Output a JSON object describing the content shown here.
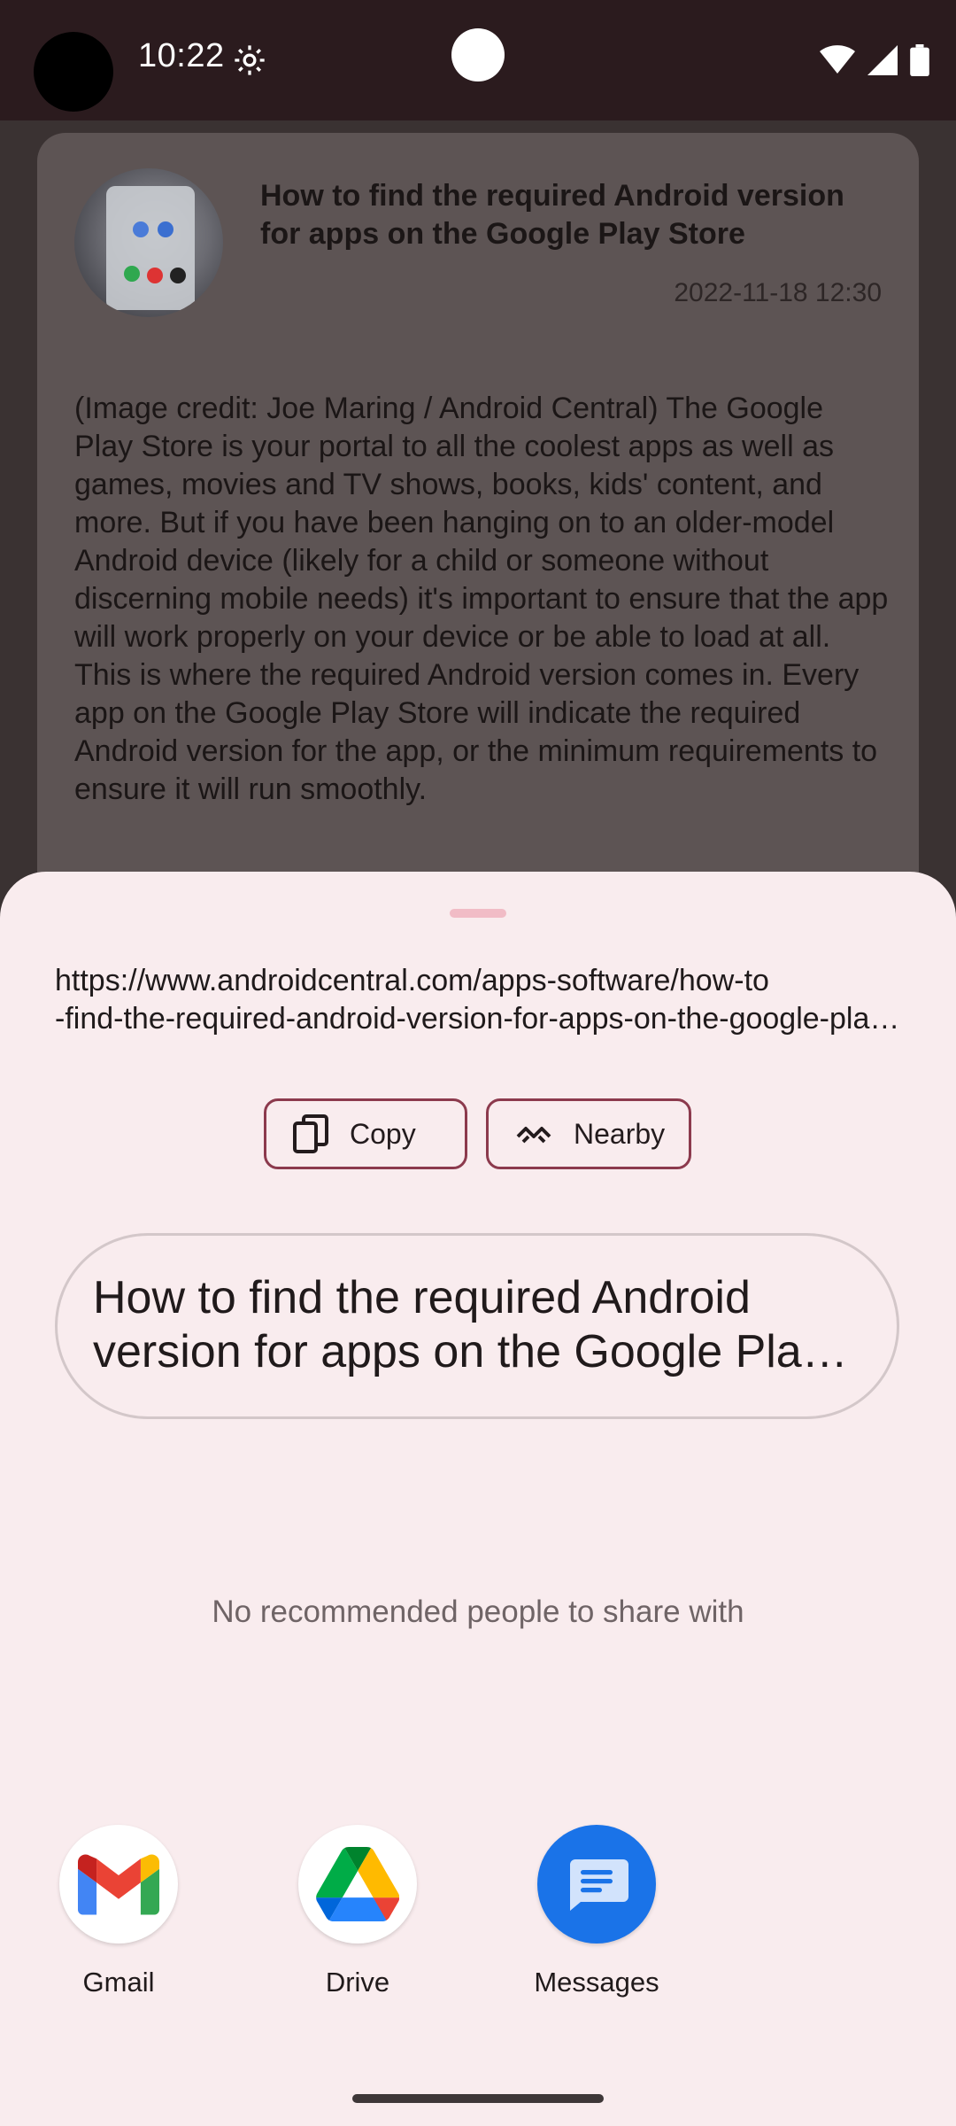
{
  "status_bar": {
    "time": "10:22",
    "icons": [
      "gear-icon",
      "wifi-icon",
      "signal-icon",
      "battery-icon"
    ]
  },
  "article": {
    "title": "How to find the required Android version for apps on the Google Play Store",
    "date": "2022-11-18 12:30",
    "body": "(Image credit: Joe Maring / Android Central) The Google Play Store is your portal to all the coolest apps as well as games, movies and TV shows, books, kids' content, and more. But if you have been hanging on to an older-model Android device (likely for a child or someone without discerning mobile needs) it's important to ensure that the app will work properly on your device or be able to load at all. This is where the required Android version comes in. Every app on the Google Play Store will indicate the required Android version for the app, or the minimum requirements to ensure it will run smoothly."
  },
  "share_sheet": {
    "url_line1": "https://www.androidcentral.com/apps-software/how-to",
    "url_line2": "-find-the-required-android-version-for-apps-on-the-google-play-store",
    "copy_label": "Copy",
    "nearby_label": "Nearby",
    "preview_text": "How to find the required Android version for apps on the Google Play Store",
    "no_recommendations": "No recommended people to share with",
    "apps": [
      {
        "label": "Gmail",
        "icon": "gmail-icon"
      },
      {
        "label": "Drive",
        "icon": "drive-icon"
      },
      {
        "label": "Messages",
        "icon": "messages-icon"
      }
    ]
  },
  "colors": {
    "status_bar_bg": "#2b1b1e",
    "sheet_bg": "#f9ecee",
    "chip_border": "#8c3a4d",
    "messages_blue": "#1a73e8"
  }
}
